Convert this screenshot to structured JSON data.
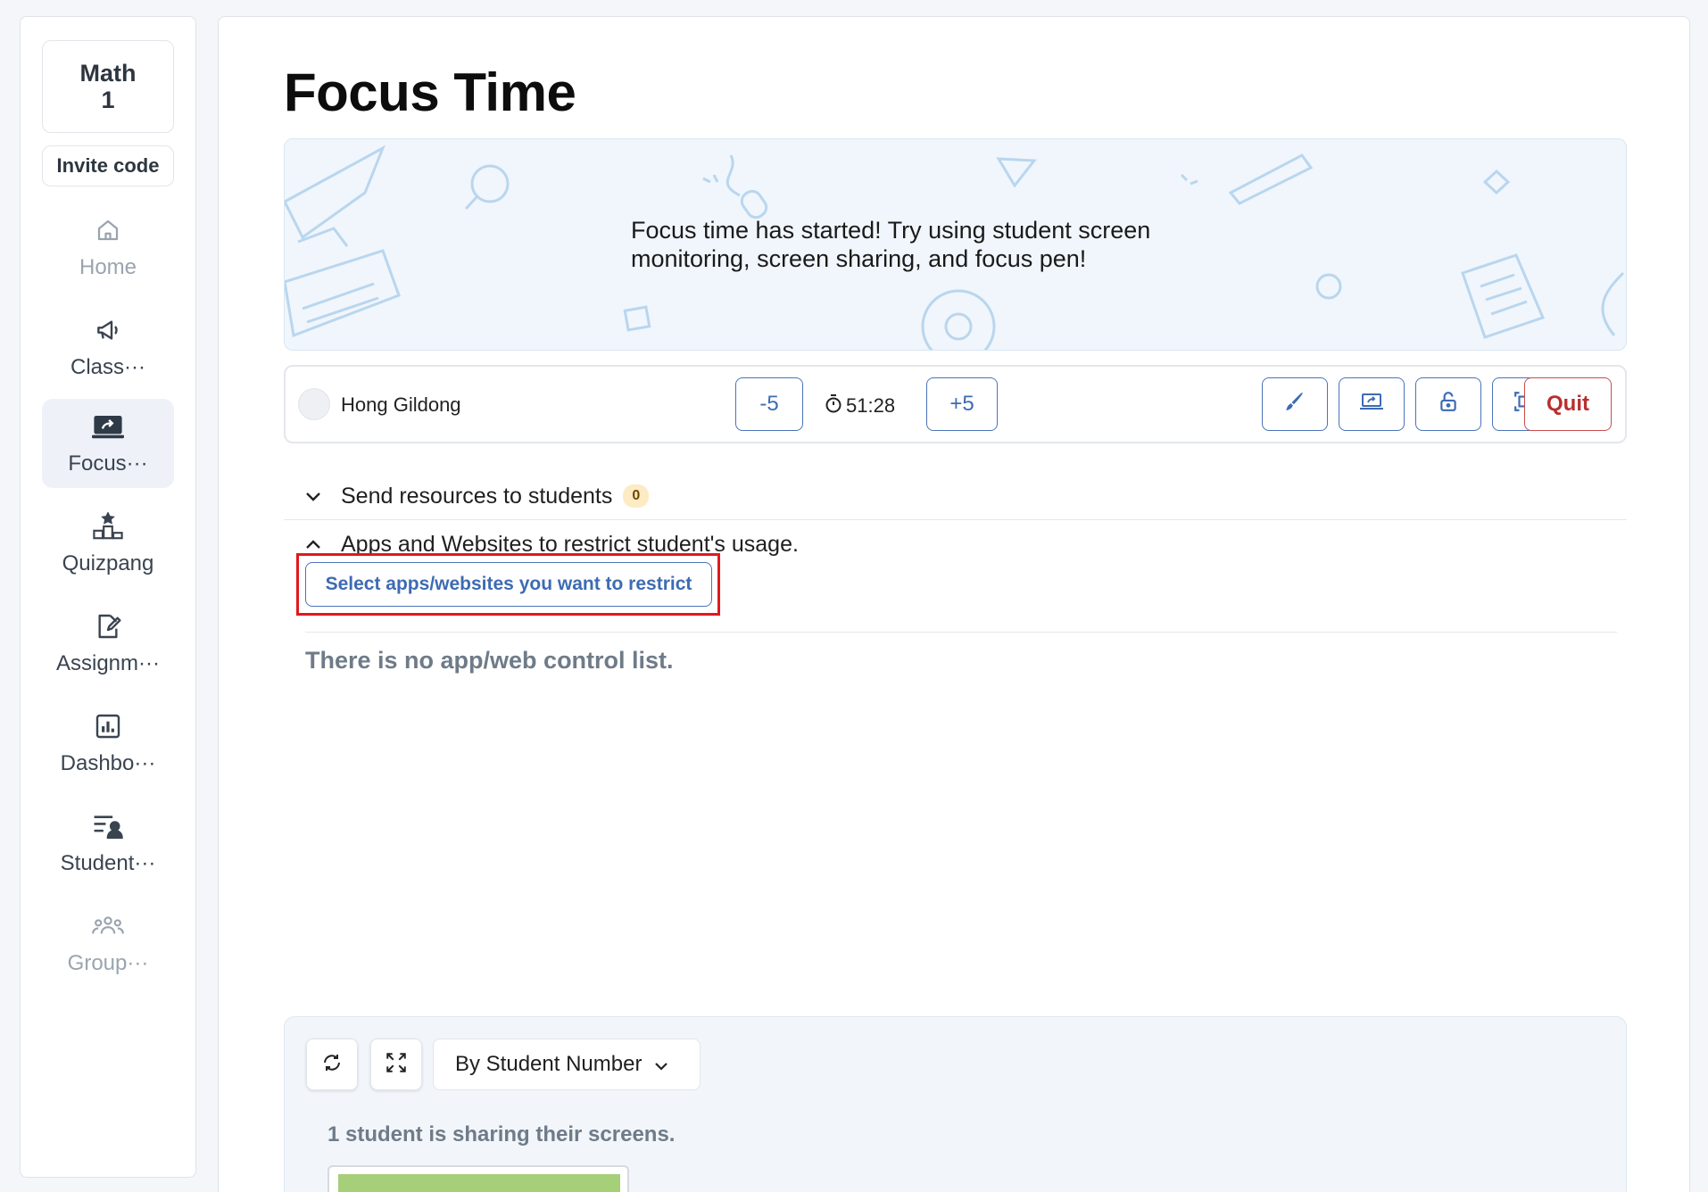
{
  "sidebar": {
    "class_name_line1": "Math",
    "class_name_line2": "1",
    "invite_code": "Invite code",
    "items": [
      {
        "label": "Home",
        "icon": "home-icon"
      },
      {
        "label": "Class···",
        "icon": "megaphone-icon"
      },
      {
        "label": "Focus···",
        "icon": "laptop-share-icon"
      },
      {
        "label": "Quizpang",
        "icon": "podium-icon"
      },
      {
        "label": "Assignm···",
        "icon": "edit-document-icon"
      },
      {
        "label": "Dashbo···",
        "icon": "bar-chart-icon"
      },
      {
        "label": "Student···",
        "icon": "student-list-icon"
      },
      {
        "label": "Group···",
        "icon": "group-icon"
      }
    ],
    "active_item": "Focus···"
  },
  "main": {
    "title": "Focus Time",
    "banner_text": "Focus time has started! Try using student screen monitoring, screen sharing, and focus pen!",
    "control_bar": {
      "student_name": "Hong Gildong",
      "minus_label": "-5",
      "timer": "51:28",
      "plus_label": "+5",
      "tools": [
        "brush-icon",
        "screen-share-icon",
        "lock-icon",
        "fullscreen-frame-icon"
      ],
      "quit_label": "Quit"
    },
    "resources": {
      "label": "Send resources to students",
      "count": "0"
    },
    "restrict": {
      "label": "Apps and Websites to restrict student's usage.",
      "button": "Select apps/websites you want to restrict",
      "empty_message": "There is no app/web control list."
    },
    "screens": {
      "sort_label": "By Student Number",
      "sharing_text": "1 student is sharing their screens."
    }
  },
  "colors": {
    "accent": "#3d6bb3",
    "danger": "#b72f2f",
    "highlight": "#e1191e",
    "badge_bg": "#fdebc4"
  }
}
